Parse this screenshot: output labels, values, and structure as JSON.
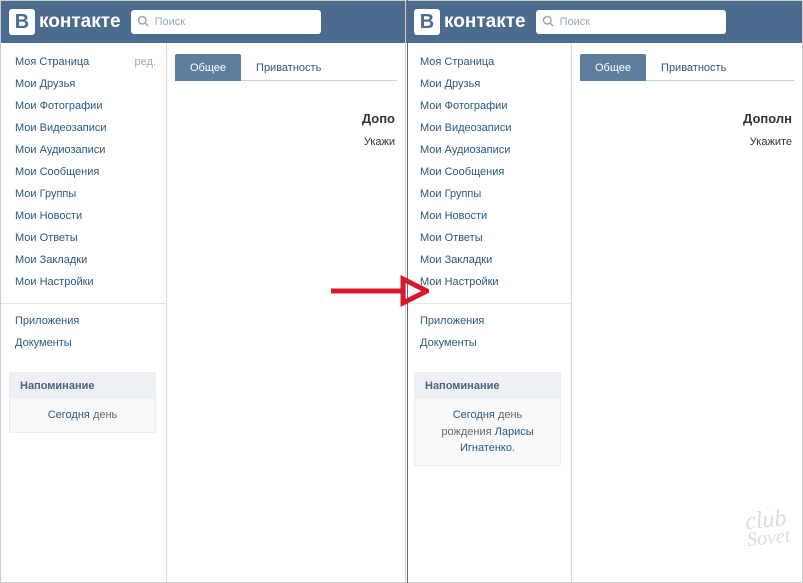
{
  "logo_letter": "В",
  "logo_text": "контакте",
  "search_placeholder": "Поиск",
  "nav_edit": "ред.",
  "nav": {
    "0": "Моя Страница",
    "1": "Мои Друзья",
    "2": "Мои Фотографии",
    "3": "Мои Видеозаписи",
    "4": "Мои Аудиозаписи",
    "5": "Мои Сообщения",
    "6": "Мои Группы",
    "7": "Мои Новости",
    "8": "Мои Ответы",
    "9": "Мои Закладки",
    "10": "Мои Настройки"
  },
  "nav2": {
    "0": "Приложения",
    "1": "Документы"
  },
  "reminder": {
    "title": "Напоминание",
    "left_line": "Сегодня день",
    "left_today": "Сегодня",
    "left_day": "день",
    "right_l1_today": "Сегодня",
    "right_l1_day": "день",
    "right_l2_birthday": "рождения",
    "right_l2_name": "Ларисы",
    "right_l3": "Игнатенко"
  },
  "tabs": {
    "active": "Общее",
    "inactive": "Приватность"
  },
  "content_left": {
    "heading": "Допо",
    "text": "Укажи"
  },
  "content_right": {
    "heading": "Дополн",
    "text": "Укажите"
  },
  "watermark": {
    "l1": "club",
    "l2": "Sovet"
  }
}
